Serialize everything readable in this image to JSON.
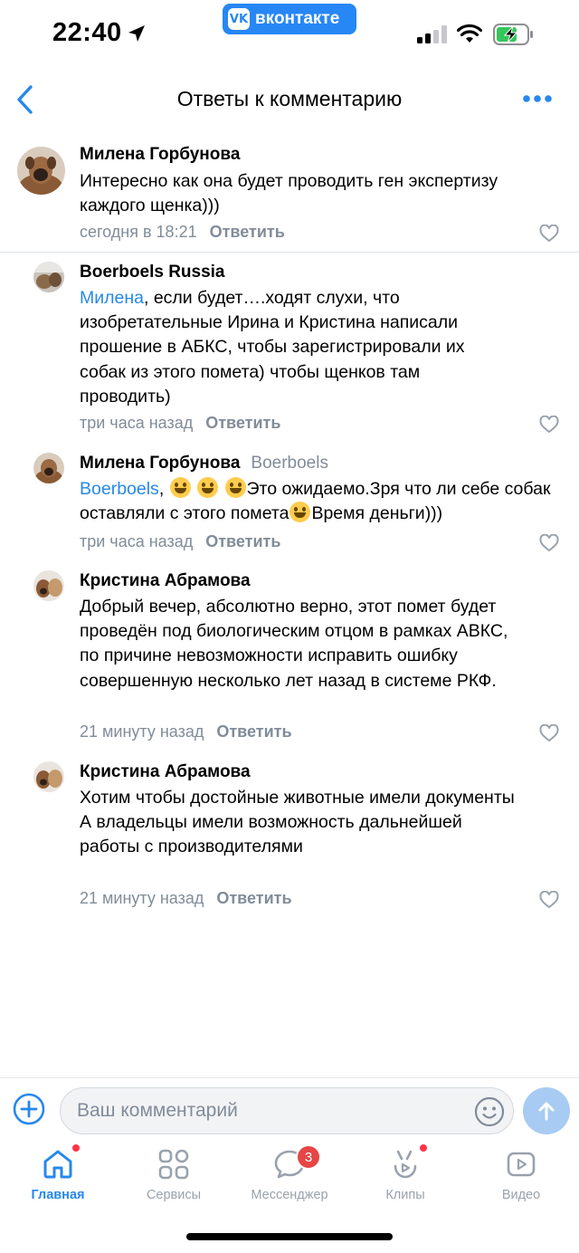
{
  "status_bar": {
    "time": "22:40",
    "app_pill": {
      "logo": "VK",
      "label": "вконтакте"
    },
    "icons": [
      "location-arrow-icon",
      "signal-icon",
      "wifi-icon",
      "battery-charging-icon"
    ]
  },
  "header": {
    "title": "Ответы к комментарию",
    "back_icon": "chevron-left-icon",
    "more_icon": "more-horizontal-icon"
  },
  "comments": [
    {
      "author": "Милена Горбунова",
      "reply_to": "",
      "mention": "",
      "text": "Интересно как она будет проводить ген экспертизу каждого щенка)))",
      "time": "сегодня в 18:21",
      "reply_label": "Ответить"
    },
    {
      "author": "Boerboels Russia",
      "reply_to": "",
      "mention": "Милена",
      "text": ", если будет….ходят слухи, что изобретательные Ирина и Кристина написали прошение в АБКС, чтобы зарегистрировали их собак из этого помета) чтобы щенков там проводить)",
      "time": "три часа назад",
      "reply_label": "Ответить"
    },
    {
      "author": "Милена Горбунова",
      "reply_to": "Boerboels",
      "mention": "Boerboels",
      "text_parts": [
        ", ",
        "Это ожидаемо.Зря что ли себе собак оставляли с этого помета",
        "Время деньги)))"
      ],
      "emoji": "grinning-face-emoji",
      "time": "три часа назад",
      "reply_label": "Ответить"
    },
    {
      "author": "Кристина Абрамова",
      "reply_to": "",
      "mention": "",
      "text": "Добрый вечер, абсолютно верно, этот помет будет проведён под биологическим отцом в рамках АВКС, по причине невозможности исправить ошибку совершенную несколько лет назад в системе РКФ.",
      "time": "21 минуту назад",
      "reply_label": "Ответить"
    },
    {
      "author": "Кристина Абрамова",
      "reply_to": "",
      "mention": "",
      "text_lines": [
        "Хотим чтобы достойные животные имели документы",
        "А владельцы имели возможность дальнейшей работы с производителями"
      ],
      "time": "21 минуту назад",
      "reply_label": "Ответить"
    }
  ],
  "composer": {
    "placeholder": "Ваш комментарий",
    "value": "",
    "add_icon": "plus-circle-icon",
    "emoji_icon": "smile-icon",
    "send_icon": "arrow-up-icon"
  },
  "tabbar": {
    "tabs": [
      {
        "label": "Главная",
        "icon": "home-icon",
        "active": true,
        "dot": true
      },
      {
        "label": "Сервисы",
        "icon": "services-grid-icon",
        "active": false
      },
      {
        "label": "Мессенджер",
        "icon": "message-icon",
        "active": false,
        "badge": "3"
      },
      {
        "label": "Клипы",
        "icon": "clips-icon",
        "active": false,
        "dot": true
      },
      {
        "label": "Видео",
        "icon": "video-icon",
        "active": false
      }
    ]
  },
  "colors": {
    "accent": "#2688EB",
    "vk_blue": "#2787F5",
    "secondary_text": "#818c99",
    "tab_inactive": "#99a2ad",
    "badge_red": "#e64646"
  }
}
